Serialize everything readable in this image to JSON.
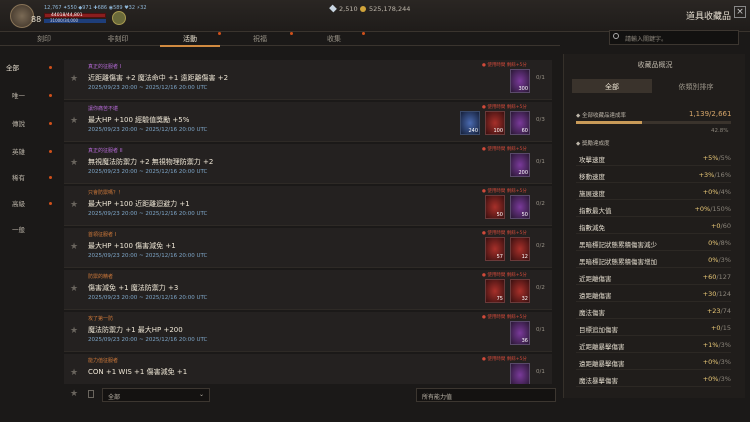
{
  "player": {
    "level": "88",
    "stats_line": "12,767  ✦550  ◆971  ✚686  ◉589  ♥32  ⚡32",
    "hp": "44018/44,801",
    "mp": "31000/34,000"
  },
  "currency": {
    "gems": "2,510",
    "gold": "525,178,244"
  },
  "window_title": "道具收藏品",
  "tabs": [
    {
      "label": "刻印"
    },
    {
      "label": "非刻印"
    },
    {
      "label": "活動"
    },
    {
      "label": "祝福"
    },
    {
      "label": "收集"
    }
  ],
  "search": {
    "placeholder": "請輸入關鍵字。"
  },
  "categories": [
    {
      "label": "全部"
    },
    {
      "label": "唯一"
    },
    {
      "label": "傳說"
    },
    {
      "label": "英雄"
    },
    {
      "label": "稀有"
    },
    {
      "label": "高級"
    },
    {
      "label": "一般"
    }
  ],
  "rows": [
    {
      "tag": "真正的征服者 I",
      "effect": "近距離傷害 +2 魔法命中 +1 遠距離傷害 +2",
      "date": "2025/09/23 20:00 ~ 2025/12/16 20:00 UTC",
      "limit": "● 使用時間 剩餘+5分",
      "count": "0/1",
      "items": [
        {
          "q": "300",
          "c": "purple"
        }
      ]
    },
    {
      "tag": "讓你痛苦不堪",
      "effect": "最大HP +100 經驗值獎勵 +5%",
      "date": "2025/09/23 20:00 ~ 2025/12/16 20:00 UTC",
      "limit": "● 使用時間 剩餘+5分",
      "count": "0/3",
      "items": [
        {
          "q": "240",
          "c": "blue"
        },
        {
          "q": "100",
          "c": "red"
        },
        {
          "q": "60",
          "c": "purple"
        }
      ]
    },
    {
      "tag": "真正的征服者 II",
      "effect": "無視魔法防禦力 +2 無視物理防禦力 +2",
      "date": "2025/09/23 20:00 ~ 2025/12/16 20:00 UTC",
      "limit": "● 使用時間 剩餘+5分",
      "count": "0/1",
      "items": [
        {
          "q": "200",
          "c": "purple"
        }
      ]
    },
    {
      "tag": "只會防禦嗎？！",
      "effect": "最大HP +100 近距離迴避力 +1",
      "date": "2025/09/23 20:00 ~ 2025/12/16 20:00 UTC",
      "limit": "● 使用時間 剩餘+5分",
      "count": "0/2",
      "items": [
        {
          "q": "50",
          "c": "red"
        },
        {
          "q": "50",
          "c": "purple"
        }
      ]
    },
    {
      "tag": "首領征服者 I",
      "effect": "最大HP +100 傷害減免 +1",
      "date": "2025/09/23 20:00 ~ 2025/12/16 20:00 UTC",
      "limit": "● 使用時間 剩餘+5分",
      "count": "0/2",
      "items": [
        {
          "q": "57",
          "c": "red"
        },
        {
          "q": "12",
          "c": "purple"
        }
      ]
    },
    {
      "tag": "防禦的精者",
      "effect": "傷害減免 +1 魔法防禦力 +3",
      "date": "2025/09/23 20:00 ~ 2025/12/16 20:00 UTC",
      "limit": "● 使用時間 剩餘+5分",
      "count": "0/2",
      "items": [
        {
          "q": "75",
          "c": "red"
        },
        {
          "q": "32",
          "c": "purple"
        }
      ]
    },
    {
      "tag": "攻了第一防",
      "effect": "魔法防禦力 +1 最大HP +200",
      "date": "2025/09/23 20:00 ~ 2025/12/16 20:00 UTC",
      "limit": "● 使用時間 剩餘+5分",
      "count": "0/1",
      "items": [
        {
          "q": "36",
          "c": "purple"
        }
      ]
    },
    {
      "tag": "能力值征服者",
      "effect": "CON +1 WIS +1 傷害減免 +1",
      "date": "",
      "limit": "● 使用時間 剩餘+5分",
      "count": "0/1",
      "items": [
        {
          "q": "",
          "c": "purple"
        }
      ]
    }
  ],
  "bottom": {
    "filter": "全部",
    "owned": "所有能力值"
  },
  "right": {
    "header": "收藏品概況",
    "tab_all": "全部",
    "tab_sort": "依類別排序",
    "rate_label": "◆ 全部收藏品達成率",
    "rate_value": "1,139/2,661",
    "percent": "42.8%",
    "progress": 0.428,
    "stats_label": "◆ 獎勵達成度",
    "stats": [
      {
        "name": "攻擊速度",
        "cur": "+5%",
        "max": "/5%"
      },
      {
        "name": "移動速度",
        "cur": "+3%",
        "max": "/16%"
      },
      {
        "name": "施展速度",
        "cur": "+0%",
        "max": "/4%"
      },
      {
        "name": "指數最大值",
        "cur": "+0%",
        "max": "/150%"
      },
      {
        "name": "指數減免",
        "cur": "+0",
        "max": "/60"
      },
      {
        "name": "黑暗標記狀態累積傷害減少",
        "cur": "0%",
        "max": "/8%"
      },
      {
        "name": "黑暗標記狀態累積傷害增加",
        "cur": "0%",
        "max": "/3%"
      },
      {
        "name": "近距離傷害",
        "cur": "+60",
        "max": "/127"
      },
      {
        "name": "遠距離傷害",
        "cur": "+30",
        "max": "/124"
      },
      {
        "name": "魔法傷害",
        "cur": "+23",
        "max": "/74"
      },
      {
        "name": "目標追加傷害",
        "cur": "+0",
        "max": "/15"
      },
      {
        "name": "近距離暴擊傷害",
        "cur": "+1%",
        "max": "/3%"
      },
      {
        "name": "遠距離暴擊傷害",
        "cur": "+0%",
        "max": "/3%"
      },
      {
        "name": "魔法暴擊傷害",
        "cur": "+0%",
        "max": "/3%"
      }
    ]
  }
}
